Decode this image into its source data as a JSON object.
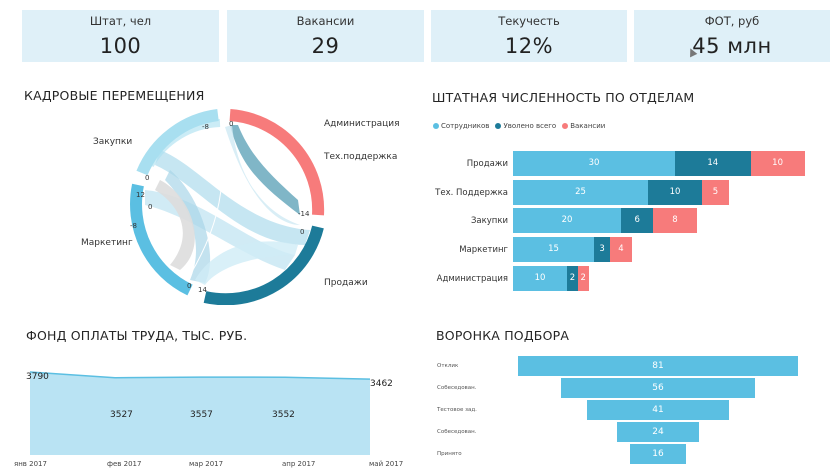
{
  "kpis": [
    {
      "label": "Штат, чел",
      "value": "100"
    },
    {
      "label": "Вакансии",
      "value": "29"
    },
    {
      "label": "Текучесть",
      "value": "12%"
    },
    {
      "label": "ФОТ, руб",
      "value": "45 млн"
    }
  ],
  "chord": {
    "title": "КАДРОВЫЕ ПЕРЕМЕЩЕНИЯ",
    "labels": {
      "admin": "Администрация",
      "support": "Тех.поддержка",
      "sales": "Продажи",
      "marketing": "Маркетинг",
      "procurement": "Закупки"
    },
    "ticks": [
      "-8",
      "0",
      "0",
      "-14",
      "0",
      "14",
      "-8",
      "0",
      "12",
      "0"
    ],
    "colors": {
      "admin": "#f77b7b",
      "support": "#f77b7b",
      "sales": "#1d7b99",
      "marketing": "#5bbfe2",
      "procurement": "#a8dff0"
    }
  },
  "headcount": {
    "title": "ШТАТНАЯ ЧИСЛЕННОСТЬ ПО ОТДЕЛАМ",
    "legend": [
      "Сотрудников",
      "Уволено всего",
      "Вакансии"
    ],
    "colors": [
      "#5bbfe2",
      "#1d7b99",
      "#f77b7b"
    ]
  },
  "payroll": {
    "title": "ФОНД ОПЛАТЫ ТРУДА, ТЫС. РУБ.",
    "fill": "#b9e3f3",
    "stroke": "#5bbfe2"
  },
  "funnel": {
    "title": "ВОРОНКА ПОДБОРА",
    "color": "#5bbfe2"
  },
  "chart_data": [
    {
      "type": "bar",
      "orientation": "horizontal",
      "stacked": true,
      "title": "ШТАТНАЯ ЧИСЛЕННОСТЬ ПО ОТДЕЛАМ",
      "categories": [
        "Продажи",
        "Тех. Поддержка",
        "Закупки",
        "Маркетинг",
        "Администрация"
      ],
      "series": [
        {
          "name": "Сотрудников",
          "values": [
            30,
            25,
            20,
            15,
            10
          ]
        },
        {
          "name": "Уволено всего",
          "values": [
            14,
            10,
            6,
            3,
            2
          ]
        },
        {
          "name": "Вакансии",
          "values": [
            10,
            5,
            8,
            4,
            2
          ]
        }
      ],
      "legend": "top-left"
    },
    {
      "type": "area",
      "title": "ФОНД ОПЛАТЫ ТРУДА, ТЫС. РУБ.",
      "x": [
        "янв 2017",
        "фев 2017",
        "мар 2017",
        "апр 2017",
        "май 2017"
      ],
      "values": [
        3790,
        3527,
        3557,
        3552,
        3462
      ]
    },
    {
      "type": "bar",
      "orientation": "funnel",
      "title": "ВОРОНКА ПОДБОРА",
      "categories": [
        "Отклик",
        "Собеседован.",
        "Тестовое зад.",
        "Собеседован.",
        "Принято"
      ],
      "values": [
        81,
        56,
        41,
        24,
        16
      ]
    }
  ]
}
